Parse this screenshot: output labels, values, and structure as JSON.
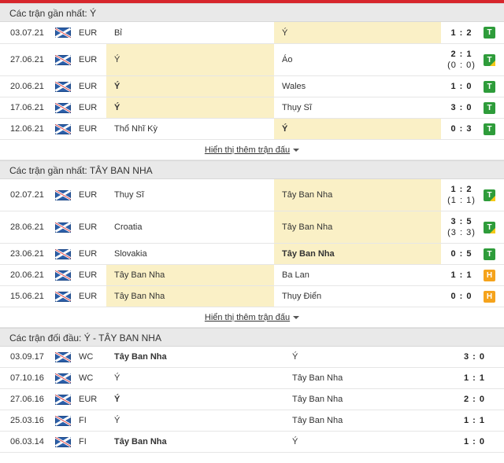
{
  "sections": [
    {
      "title": "Các trận gần nhất: Ý",
      "more_label": "Hiển thị thêm trận đấu",
      "rows": [
        {
          "date": "03.07.21",
          "comp": "EUR",
          "home": "Bỉ",
          "away": "Ý",
          "score": "1 : 2",
          "sub": "",
          "result": "T",
          "home_hl": false,
          "away_hl": true,
          "home_bold": false,
          "away_bold": false,
          "tri": false
        },
        {
          "date": "27.06.21",
          "comp": "EUR",
          "home": "Ý",
          "away": "Áo",
          "score": "2 : 1",
          "sub": "(0 : 0)",
          "result": "T",
          "home_hl": true,
          "away_hl": false,
          "home_bold": false,
          "away_bold": false,
          "tri": true
        },
        {
          "date": "20.06.21",
          "comp": "EUR",
          "home": "Ý",
          "away": "Wales",
          "score": "1 : 0",
          "sub": "",
          "result": "T",
          "home_hl": true,
          "away_hl": false,
          "home_bold": true,
          "away_bold": false,
          "tri": false
        },
        {
          "date": "17.06.21",
          "comp": "EUR",
          "home": "Ý",
          "away": "Thụy Sĩ",
          "score": "3 : 0",
          "sub": "",
          "result": "T",
          "home_hl": true,
          "away_hl": false,
          "home_bold": true,
          "away_bold": false,
          "tri": false
        },
        {
          "date": "12.06.21",
          "comp": "EUR",
          "home": "Thổ Nhĩ Kỳ",
          "away": "Ý",
          "score": "0 : 3",
          "sub": "",
          "result": "T",
          "home_hl": false,
          "away_hl": true,
          "home_bold": false,
          "away_bold": true,
          "tri": false
        }
      ]
    },
    {
      "title": "Các trận gần nhất: TÂY BAN NHA",
      "more_label": "Hiển thị thêm trận đấu",
      "rows": [
        {
          "date": "02.07.21",
          "comp": "EUR",
          "home": "Thụy Sĩ",
          "away": "Tây Ban Nha",
          "score": "1 : 2",
          "sub": "(1 : 1)",
          "result": "T",
          "home_hl": false,
          "away_hl": true,
          "home_bold": false,
          "away_bold": false,
          "tri": true
        },
        {
          "date": "28.06.21",
          "comp": "EUR",
          "home": "Croatia",
          "away": "Tây Ban Nha",
          "score": "3 : 5",
          "sub": "(3 : 3)",
          "result": "T",
          "home_hl": false,
          "away_hl": true,
          "home_bold": false,
          "away_bold": false,
          "tri": true
        },
        {
          "date": "23.06.21",
          "comp": "EUR",
          "home": "Slovakia",
          "away": "Tây Ban Nha",
          "score": "0 : 5",
          "sub": "",
          "result": "T",
          "home_hl": false,
          "away_hl": true,
          "home_bold": false,
          "away_bold": true,
          "tri": false
        },
        {
          "date": "20.06.21",
          "comp": "EUR",
          "home": "Tây Ban Nha",
          "away": "Ba Lan",
          "score": "1 : 1",
          "sub": "",
          "result": "H",
          "home_hl": true,
          "away_hl": false,
          "home_bold": false,
          "away_bold": false,
          "tri": false
        },
        {
          "date": "15.06.21",
          "comp": "EUR",
          "home": "Tây Ban Nha",
          "away": "Thụy Điển",
          "score": "0 : 0",
          "sub": "",
          "result": "H",
          "home_hl": true,
          "away_hl": false,
          "home_bold": false,
          "away_bold": false,
          "tri": false
        }
      ]
    }
  ],
  "h2h": {
    "title": "Các trận đối đầu: Ý - TÂY BAN NHA",
    "rows": [
      {
        "date": "03.09.17",
        "comp": "WC",
        "home": "Tây Ban Nha",
        "away": "Ý",
        "score": "3 : 0",
        "home_bold": true,
        "away_bold": false
      },
      {
        "date": "07.10.16",
        "comp": "WC",
        "home": "Ý",
        "away": "Tây Ban Nha",
        "score": "1 : 1",
        "home_bold": false,
        "away_bold": false
      },
      {
        "date": "27.06.16",
        "comp": "EUR",
        "home": "Ý",
        "away": "Tây Ban Nha",
        "score": "2 : 0",
        "home_bold": true,
        "away_bold": false
      },
      {
        "date": "25.03.16",
        "comp": "FI",
        "home": "Ý",
        "away": "Tây Ban Nha",
        "score": "1 : 1",
        "home_bold": false,
        "away_bold": false
      },
      {
        "date": "06.03.14",
        "comp": "FI",
        "home": "Tây Ban Nha",
        "away": "Ý",
        "score": "1 : 0",
        "home_bold": true,
        "away_bold": false
      }
    ]
  },
  "colors": {
    "accent": "#d7262c",
    "win": "#2e9c3a",
    "draw": "#f5a31c",
    "highlight": "#faf0c6"
  },
  "icons": {
    "competition": "world-flag-icon",
    "more": "caret-down-icon"
  }
}
